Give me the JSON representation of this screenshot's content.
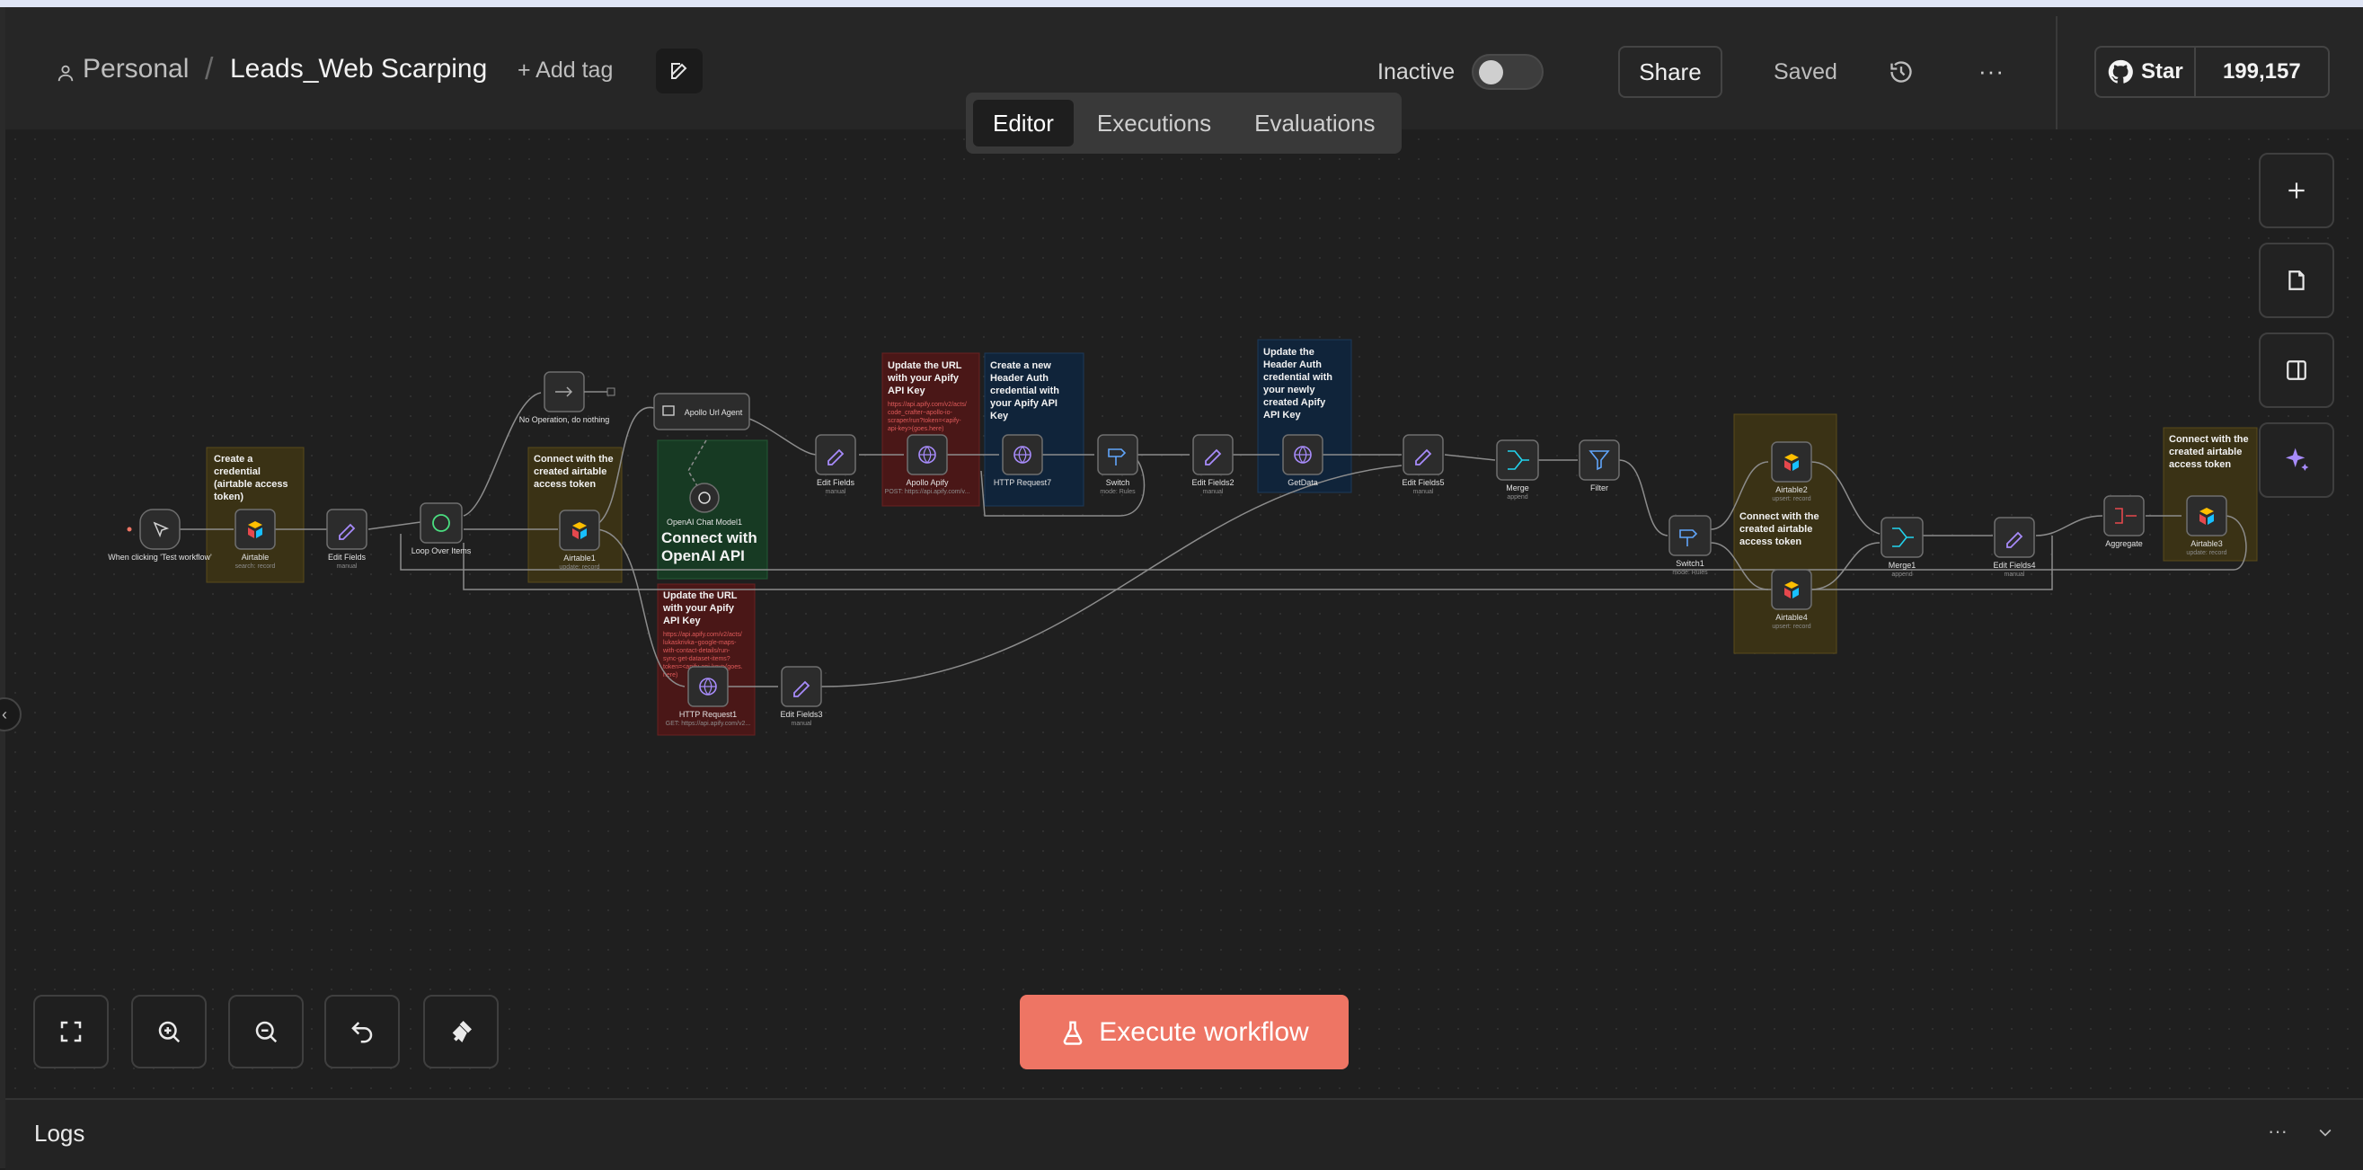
{
  "header": {
    "project": "Personal",
    "workflow_name": "Leads_Web Scarping",
    "add_tag": "+ Add tag",
    "status_label": "Inactive",
    "share_label": "Share",
    "saved_label": "Saved",
    "more_label": "···",
    "github_star": "Star",
    "github_count": "199,157"
  },
  "tabs": [
    "Editor",
    "Executions",
    "Evaluations"
  ],
  "canvas": {
    "nodes": {
      "trigger": "When clicking 'Test workflow'",
      "airtable": "Airtable",
      "airtable_sub": "search: record",
      "edit_fields": "Edit Fields",
      "loop": "Loop Over Items",
      "noop": "No Operation, do nothing",
      "airtable1": "Airtable1",
      "airtable1_sub": "update: record",
      "agent": "Apollo Url Agent",
      "chat_model": "OpenAI Chat Model1",
      "edit_fields_b": "Edit Fields",
      "apollo_apify": "Apollo Apify",
      "apollo_apify_sub": "POST: https://api.apify.com/v...",
      "http7": "HTTP Request7",
      "switch": "Switch",
      "switch_sub": "mode: Rules",
      "edit2": "Edit Fields2",
      "getdata": "GetData",
      "edit5": "Edit Fields5",
      "merge": "Merge",
      "merge_sub": "append",
      "filter": "Filter",
      "switch1": "Switch1",
      "switch1_sub": "mode: Rules",
      "airtable2": "Airtable2",
      "airtable2_sub": "upsert: record",
      "airtable4": "Airtable4",
      "airtable4_sub": "upsert: record",
      "merge1": "Merge1",
      "merge1_sub": "append",
      "edit4": "Edit Fields4",
      "aggregate": "Aggregate",
      "airtable3": "Airtable3",
      "airtable3_sub": "update: record",
      "http1": "HTTP Request1",
      "http1_sub": "GET: https://api.apify.com/v2...",
      "edit3": "Edit Fields3",
      "manual": "manual"
    },
    "notes": {
      "n1": [
        "Create a",
        "credential",
        "(airtable access",
        "token)"
      ],
      "n2": [
        "Connect with the",
        "created airtable",
        "access token"
      ],
      "n3": [
        "Connect with",
        "OpenAI API"
      ],
      "n4": [
        "Update the URL",
        "with your Apify",
        "API Key"
      ],
      "n4_url": [
        "https://api.apify.com/v2/acts/",
        "code_crafter~apollo-io-",
        "scraper/run?token=<apify-",
        "api-key>(goes.here)"
      ],
      "n5": [
        "Create a new",
        "Header Auth",
        "credential with",
        "your Apify API",
        "Key"
      ],
      "n6": [
        "Update the",
        "Header Auth",
        "credential with",
        "your newly",
        "created Apify",
        "API Key"
      ],
      "n7": [
        "Connect with the",
        "created airtable",
        "access token"
      ],
      "n8": [
        "Connect with the",
        "created airtable",
        "access token"
      ],
      "n9": [
        "Update the URL",
        "with your Apify",
        "API Key"
      ],
      "n9_url": [
        "https://api.apify.com/v2/acts/",
        "lukaskrivka~google-maps-",
        "with-contact-details/run-",
        "sync-get-dataset-items?",
        "token=<apify-api-key>(goes.",
        "here)"
      ]
    }
  },
  "execute_label": "Execute workflow",
  "logs": {
    "title": "Logs",
    "more": "···"
  },
  "colors": {
    "accent": "#ee7564",
    "note_yellow": "#3a3215",
    "note_red": "#4a1717",
    "note_blue": "#10243a",
    "note_green": "#173a23"
  }
}
